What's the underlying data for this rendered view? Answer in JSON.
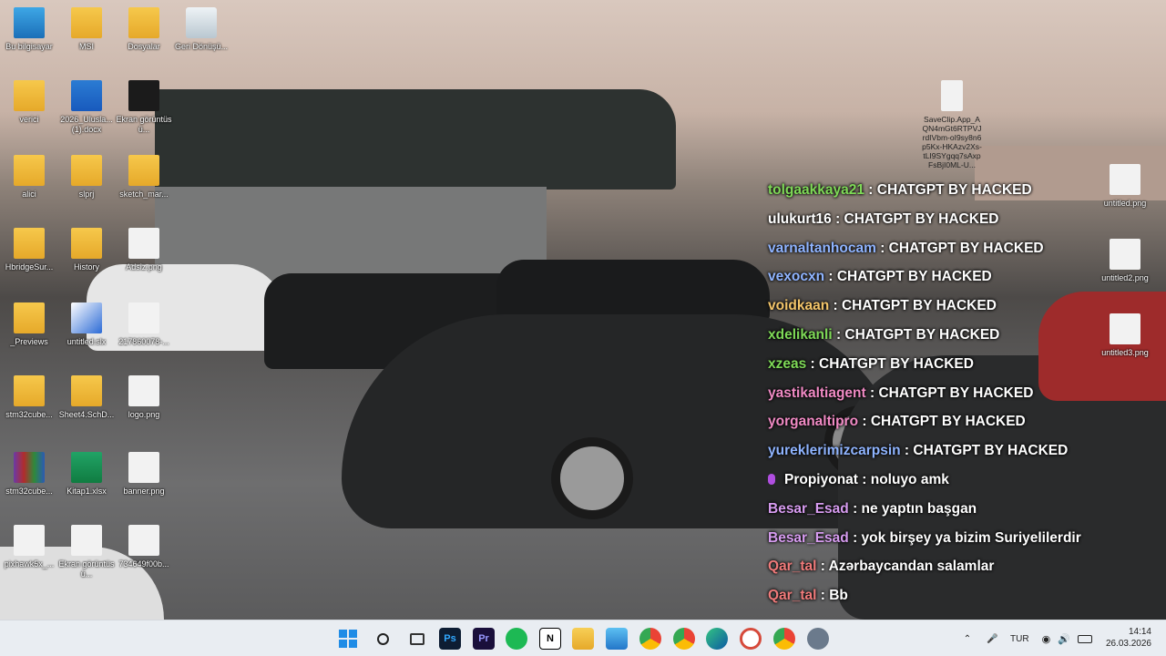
{
  "desktop": {
    "icons": [
      {
        "label": "Bu bilgisayar",
        "icon": "monitor-icon"
      },
      {
        "label": "MSI",
        "icon": "user-folder-icon"
      },
      {
        "label": "Dosyalar",
        "icon": "folder-icon"
      },
      {
        "label": "Geri Dönüşü...",
        "icon": "recycle-bin-icon"
      },
      {
        "label": "verici",
        "icon": "folder-icon"
      },
      {
        "label": "2026_Ulusla...(1).docx",
        "icon": "word-doc-icon"
      },
      {
        "label": "Ekran görüntüsü...",
        "icon": "screenshot-thumb-icon"
      },
      {
        "label": "alici",
        "icon": "folder-icon"
      },
      {
        "label": "slprj",
        "icon": "folder-icon"
      },
      {
        "label": "sketch_mar...",
        "icon": "folder-icon"
      },
      {
        "label": "HbridgeSur...",
        "icon": "folder-icon"
      },
      {
        "label": "History",
        "icon": "folder-icon"
      },
      {
        "label": "Adsiz.png",
        "icon": "image-thumb-icon"
      },
      {
        "label": "_Previews",
        "icon": "folder-icon"
      },
      {
        "label": "untitled.slx",
        "icon": "simulink-icon"
      },
      {
        "label": "217860078-...",
        "icon": "image-thumb-icon"
      },
      {
        "label": "stm32cube...",
        "icon": "folder-icon"
      },
      {
        "label": "Sheet4.SchD...",
        "icon": "folder-icon"
      },
      {
        "label": "logo.png",
        "icon": "image-thumb-icon"
      },
      {
        "label": "stm32cube...",
        "icon": "winrar-icon"
      },
      {
        "label": "Kitap1.xlsx",
        "icon": "excel-icon"
      },
      {
        "label": "banner.png",
        "icon": "image-thumb-icon"
      },
      {
        "label": "pixhawk5x_...",
        "icon": "image-thumb-icon"
      },
      {
        "label": "Ekran görüntüsü...",
        "icon": "image-thumb-icon"
      },
      {
        "label": "734649f00b...",
        "icon": "image-thumb-icon"
      },
      {
        "label": "SaveClip.App_AQN4mGt6RTPVJrdIVbm-oI9sy8n6p5Kx-HKAzv2Xs-tLI9SYgqq7sAxpFsBjI0ML-U...",
        "icon": "image-thumb-icon"
      },
      {
        "label": "untitled.png",
        "icon": "image-thumb-icon"
      },
      {
        "label": "untitled2.png",
        "icon": "image-thumb-icon"
      },
      {
        "label": "untitled3.png",
        "icon": "image-thumb-icon"
      }
    ]
  },
  "chat": {
    "messages": [
      {
        "user": "tolgaakkaya21",
        "color": "#7ed957",
        "text": " : CHATGPT BY HACKED"
      },
      {
        "user": "ulukurt16",
        "color": "#ffffff",
        "text": " : CHATGPT BY HACKED"
      },
      {
        "user": "varnaltanhocam",
        "color": "#8fb4ff",
        "text": " : CHATGPT BY HACKED"
      },
      {
        "user": "vexocxn",
        "color": "#8fb4ff",
        "text": " : CHATGPT BY HACKED"
      },
      {
        "user": "voidkaan",
        "color": "#f3c56a",
        "text": " : CHATGPT BY HACKED"
      },
      {
        "user": "xdelikanli",
        "color": "#7ed957",
        "text": " : CHATGPT BY HACKED"
      },
      {
        "user": "xzeas",
        "color": "#7ed957",
        "text": " : CHATGPT BY HACKED"
      },
      {
        "user": "yastikaltiagent",
        "color": "#f08ac4",
        "text": " : CHATGPT BY HACKED"
      },
      {
        "user": "yorganaltipro",
        "color": "#f08ac4",
        "text": " : CHATGPT BY HACKED"
      },
      {
        "user": "yureklerimizcarpsin",
        "color": "#8fb4ff",
        "text": " : CHATGPT BY HACKED"
      },
      {
        "user": "Propiyonat",
        "color": "#ffffff",
        "text": " : noluyo amk",
        "badge": true
      },
      {
        "user": "Besar_Esad",
        "color": "#d79cf0",
        "text": " : ne yaptın başgan"
      },
      {
        "user": "Besar_Esad",
        "color": "#d79cf0",
        "text": " : yok birşey ya bizim Suriyelilerdir"
      },
      {
        "user": "Qar_tal",
        "color": "#f07a7a",
        "text": " : Azərbaycandan salamlar"
      },
      {
        "user": "Qar_tal",
        "color": "#f07a7a",
        "text": " : Bb"
      }
    ]
  },
  "taskbar": {
    "apps": [
      {
        "name": "start-icon",
        "label": ""
      },
      {
        "name": "search-icon",
        "label": ""
      },
      {
        "name": "task-view-icon",
        "label": ""
      },
      {
        "name": "photoshop-icon",
        "label": "Ps"
      },
      {
        "name": "premiere-icon",
        "label": "Pr"
      },
      {
        "name": "spotify-icon",
        "label": ""
      },
      {
        "name": "notion-icon",
        "label": "N"
      },
      {
        "name": "file-explorer-icon",
        "label": ""
      },
      {
        "name": "photos-icon",
        "label": ""
      },
      {
        "name": "chrome-icon",
        "label": ""
      },
      {
        "name": "chrome-profile-icon",
        "label": ""
      },
      {
        "name": "edge-icon",
        "label": ""
      },
      {
        "name": "chrome-alt-icon",
        "label": ""
      },
      {
        "name": "chrome-profile2-icon",
        "label": ""
      },
      {
        "name": "settings-icon",
        "label": ""
      }
    ],
    "tray": {
      "language": "TUR",
      "time": "14:14",
      "date": "26.03.2026"
    }
  }
}
